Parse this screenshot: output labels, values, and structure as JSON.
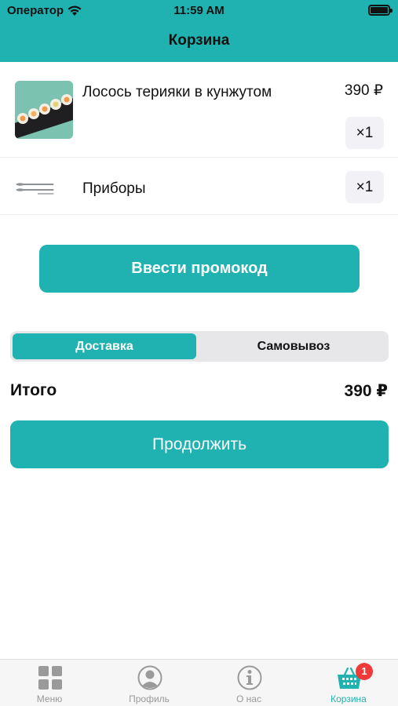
{
  "status_bar": {
    "carrier": "Оператор",
    "time": "11:59 AM"
  },
  "nav": {
    "title": "Корзина"
  },
  "cart": {
    "items": [
      {
        "name": "Лосось терияки в кунжутом",
        "price": "390 ₽",
        "quantity": "×1",
        "image": "sushi-roll-photo"
      },
      {
        "name": "Приборы",
        "quantity": "×1",
        "image": "cutlery-icon"
      }
    ]
  },
  "promo_button": "Ввести промокод",
  "delivery_segment": {
    "options": [
      "Доставка",
      "Самовывоз"
    ],
    "selected": "Доставка"
  },
  "total": {
    "label": "Итого",
    "value": "390 ₽"
  },
  "continue_button": "Продолжить",
  "tab_bar": {
    "tabs": [
      {
        "label": "Меню",
        "icon": "grid-icon"
      },
      {
        "label": "Профиль",
        "icon": "profile-icon"
      },
      {
        "label": "О нас",
        "icon": "info-icon"
      },
      {
        "label": "Корзина",
        "icon": "basket-icon",
        "badge": "1"
      }
    ],
    "active": "Корзина"
  },
  "colors": {
    "accent": "#20b2b1",
    "badge": "#f03a3a",
    "inactive": "#9a9a9a"
  }
}
